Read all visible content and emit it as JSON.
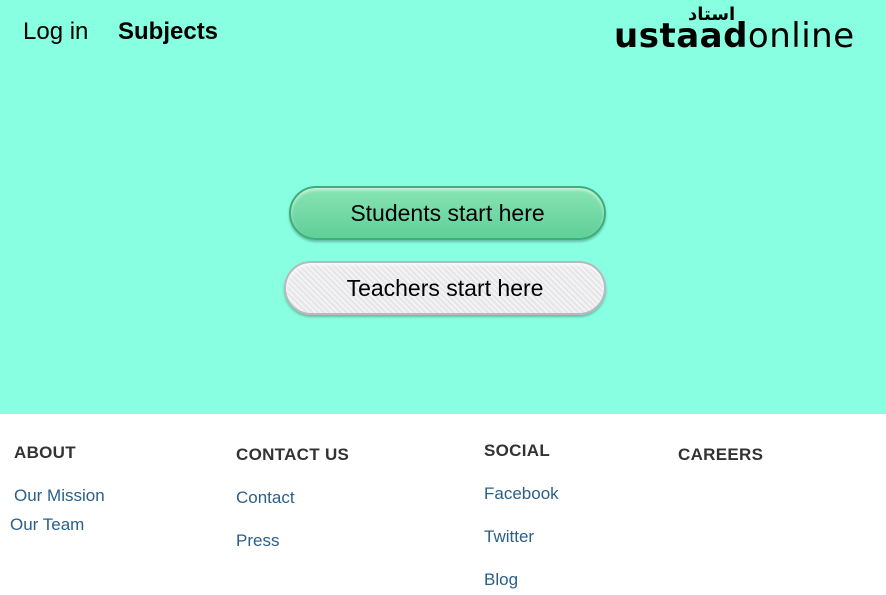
{
  "header": {
    "login_label": "Log in",
    "subjects_label": "Subjects",
    "logo": {
      "urdu": "استاد",
      "brand_bold": "ustaad",
      "brand_light": "online"
    }
  },
  "hero": {
    "students_button": "Students start here",
    "teachers_button": "Teachers start here"
  },
  "footer": {
    "about": {
      "heading": "ABOUT",
      "links": [
        "Our Mission",
        "Our Team"
      ]
    },
    "contact": {
      "heading": "CONTACT US",
      "links": [
        "Contact",
        "Press"
      ]
    },
    "social": {
      "heading": "SOCIAL",
      "links": [
        "Facebook",
        "Twitter",
        "Blog"
      ]
    },
    "careers": {
      "heading": "CAREERS"
    }
  },
  "colors": {
    "hero_bg": "#87ffe0",
    "students_button": "#6ad6a1",
    "link": "#2a5f8a"
  }
}
